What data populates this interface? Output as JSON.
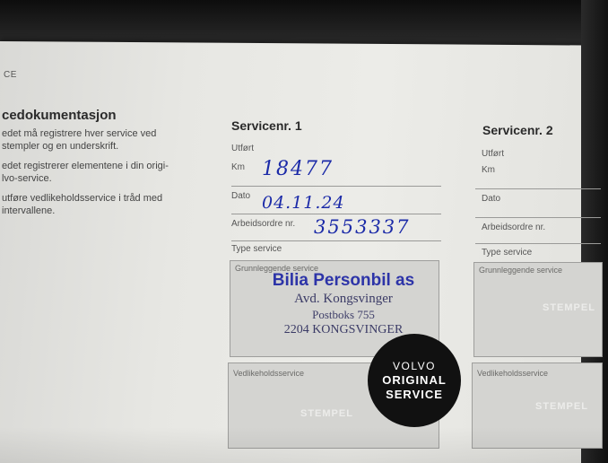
{
  "header": {
    "label": "CE"
  },
  "left": {
    "title": "cedokumentasjon",
    "lines": [
      "edet må registrere hver service ved",
      "stempler og en underskrift.",
      "edet registrerer elementene i din origi-",
      "lvo-service.",
      "utføre vedlikeholdsservice i tråd med",
      "intervallene."
    ]
  },
  "service1": {
    "title": "Servicenr. 1",
    "utfort": "Utført",
    "km_label": "Km",
    "km_value": "18477",
    "dato_label": "Dato",
    "dato_value": "04.11.24",
    "arbeid_label": "Arbeidsordre nr.",
    "arbeid_value": "3553337",
    "type_label": "Type service",
    "grunn_label": "Grunnleggende service",
    "vedlike_label": "Vedlikeholdsservice",
    "stempel": "STEMPEL"
  },
  "service2": {
    "title": "Servicenr. 2",
    "utfort": "Utført",
    "km_label": "Km",
    "dato_label": "Dato",
    "arbeid_label": "Arbeidsordre nr.",
    "type_label": "Type service",
    "grunn_label": "Grunnleggende service",
    "vedlike_label": "Vedlikeholdsservice",
    "stempel": "STEMPEL"
  },
  "stamp": {
    "line1": "Bilia Personbil as",
    "line2": "Avd. Kongsvinger",
    "line3": "Postboks 755",
    "line4": "2204 KONGSVINGER"
  },
  "badge": {
    "line1": "VOLVO",
    "line2": "ORIGINAL",
    "line3": "SERVICE"
  }
}
